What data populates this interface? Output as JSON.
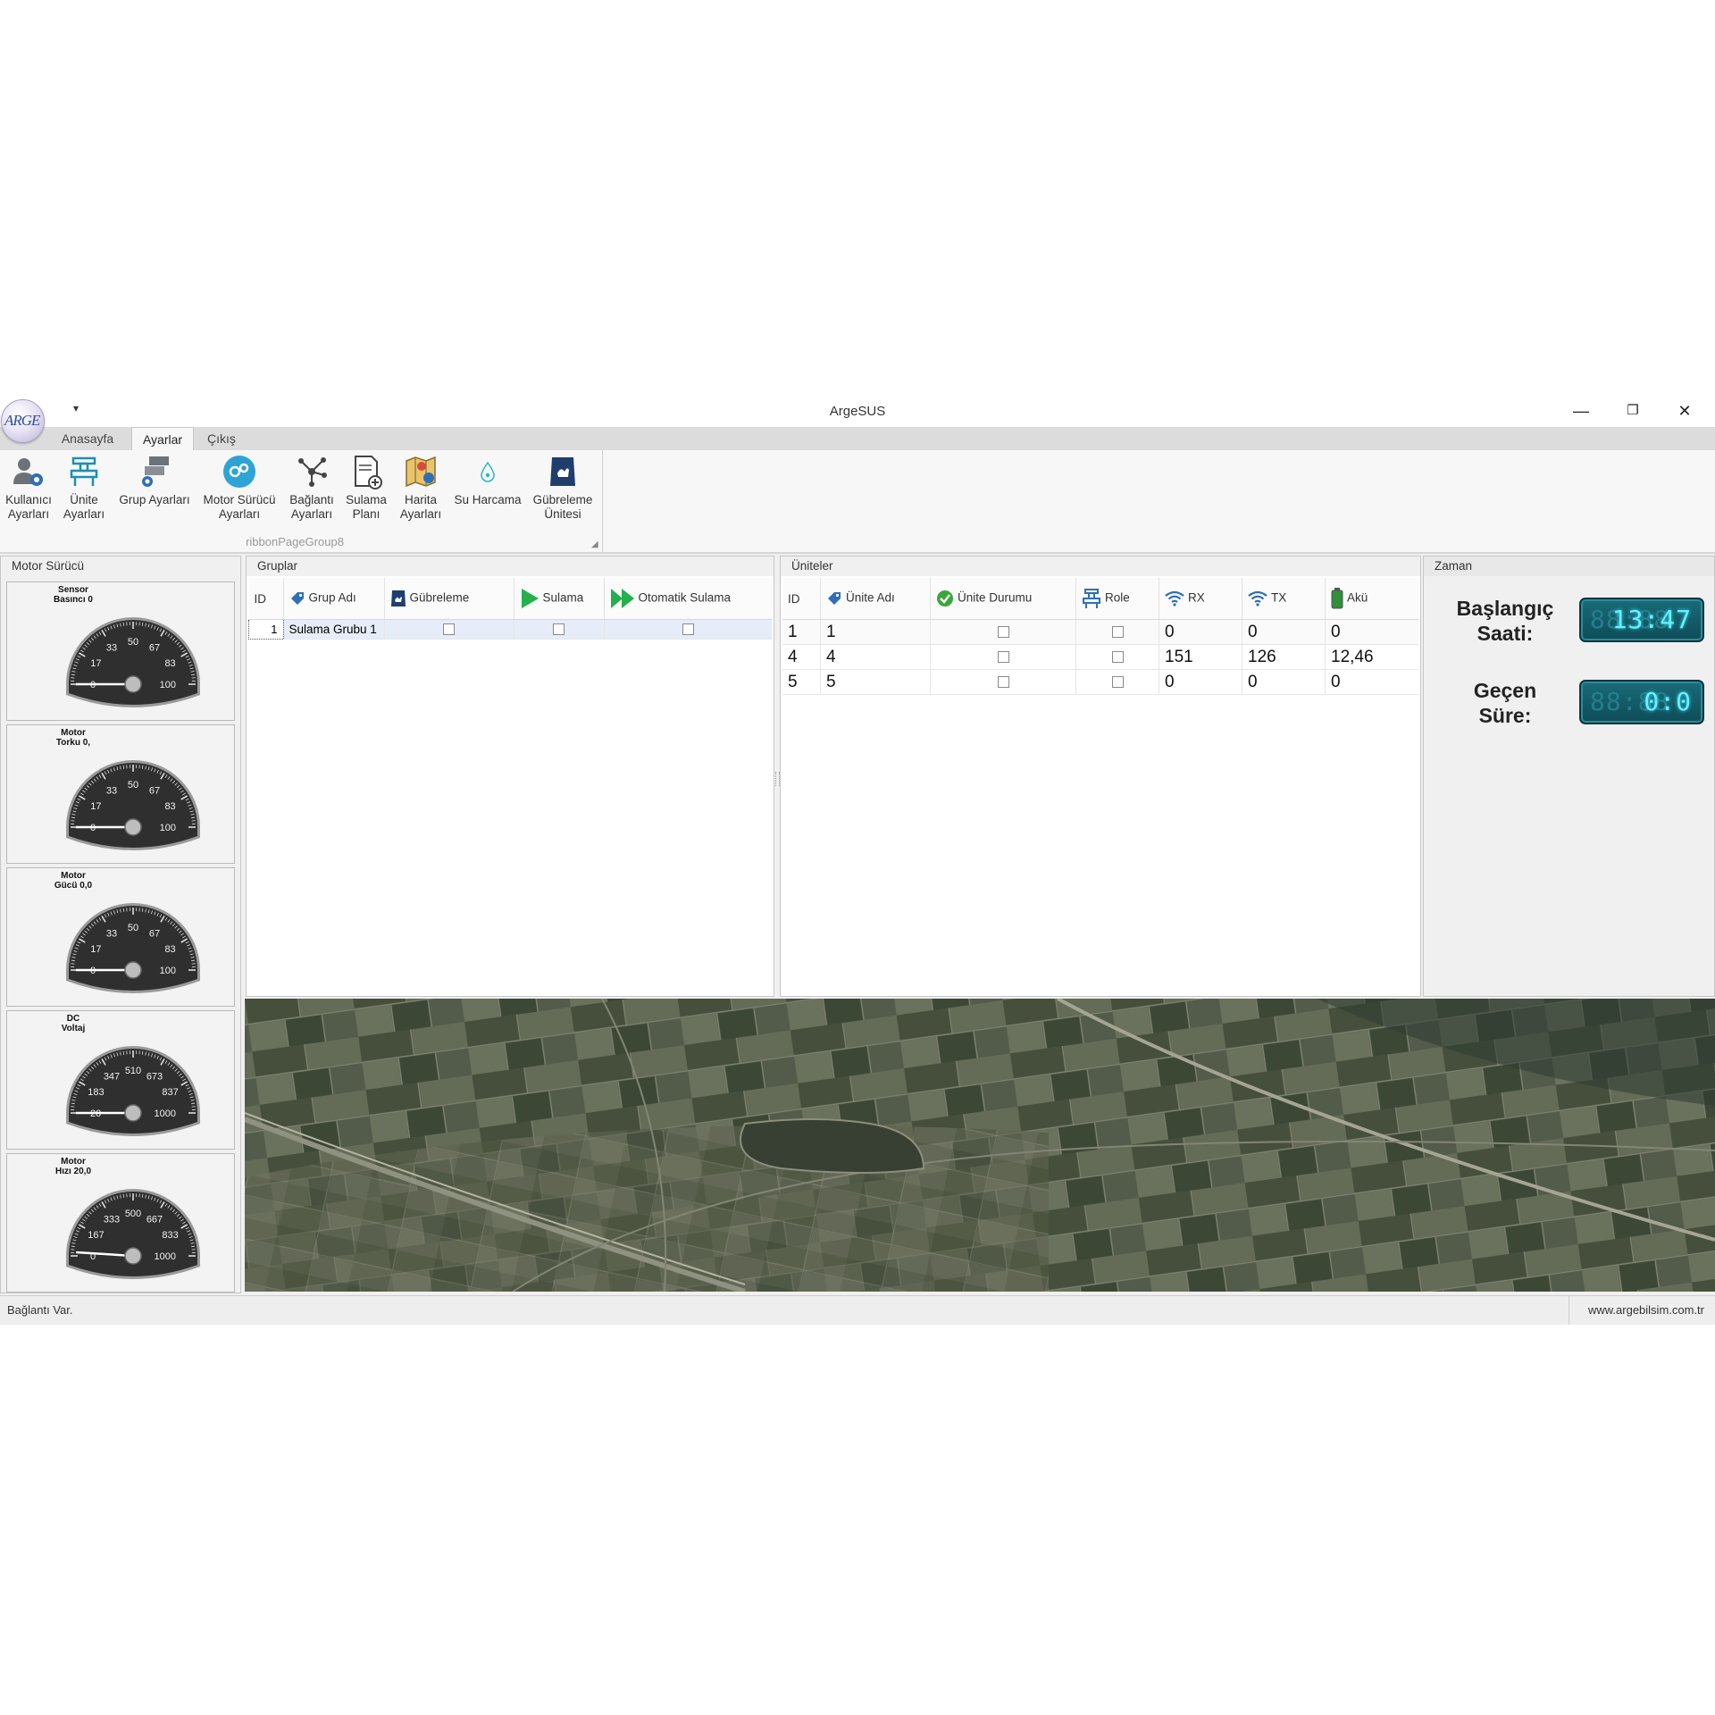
{
  "app": {
    "logo_text": "ARGE",
    "title": "ArgeSUS"
  },
  "window_controls": {
    "minimize": "—",
    "maximize": "❐",
    "close": "✕"
  },
  "tabs": [
    {
      "label": "Anasayfa"
    },
    {
      "label": "Ayarlar"
    },
    {
      "label": "Çıkış"
    }
  ],
  "ribbon": {
    "group_caption": "ribbonPageGroup8",
    "buttons": [
      {
        "line1": "Kullanıcı",
        "line2": "Ayarları",
        "icon": "user-settings-icon"
      },
      {
        "line1": "Ünite",
        "line2": "Ayarları",
        "icon": "unit-settings-icon"
      },
      {
        "line1": "Grup Ayarları",
        "line2": "",
        "icon": "group-settings-icon"
      },
      {
        "line1": "Motor Sürücü",
        "line2": "Ayarları",
        "icon": "motor-driver-icon"
      },
      {
        "line1": "Bağlantı",
        "line2": "Ayarları",
        "icon": "connection-icon"
      },
      {
        "line1": "Sulama",
        "line2": "Planı",
        "icon": "irrigation-plan-icon"
      },
      {
        "line1": "Harita",
        "line2": "Ayarları",
        "icon": "map-settings-icon"
      },
      {
        "line1": "Su Harcama",
        "line2": "",
        "icon": "water-drop-icon"
      },
      {
        "line1": "Gübreleme",
        "line2": "Ünitesi",
        "icon": "fertilizer-bag-icon"
      }
    ]
  },
  "motor_panel": {
    "title": "Motor Sürücü",
    "gauges": [
      {
        "label1": "Sensor",
        "label2": "Basıncı 0",
        "ticks": [
          "0",
          "17",
          "33",
          "50",
          "67",
          "83",
          "100"
        ],
        "value_fraction": 0
      },
      {
        "label1": "Motor",
        "label2": "Torku 0,",
        "ticks": [
          "0",
          "17",
          "33",
          "50",
          "67",
          "83",
          "100"
        ],
        "value_fraction": 0
      },
      {
        "label1": "Motor",
        "label2": "Gücü 0,0",
        "ticks": [
          "0",
          "17",
          "33",
          "50",
          "67",
          "83",
          "100"
        ],
        "value_fraction": 0
      },
      {
        "label1": "DC",
        "label2": "Voltaj",
        "ticks": [
          "20",
          "183",
          "347",
          "510",
          "673",
          "837",
          "1000"
        ],
        "value_fraction": 0
      },
      {
        "label1": "Motor",
        "label2": "Hızı 20,0",
        "ticks": [
          "0",
          "167",
          "333",
          "500",
          "667",
          "833",
          "1000"
        ],
        "value_fraction": 0.02
      }
    ]
  },
  "groups_panel": {
    "title": "Gruplar",
    "columns": {
      "id": "ID",
      "name": "Grup Adı",
      "fert": "Gübreleme",
      "irr": "Sulama",
      "auto": "Otomatik Sulama"
    },
    "rows": [
      {
        "id": "1",
        "name": "Sulama Grubu 1",
        "fert": false,
        "irr": false,
        "auto": false
      }
    ]
  },
  "units_panel": {
    "title": "Üniteler",
    "columns": {
      "id": "ID",
      "name": "Ünite Adı",
      "status": "Ünite Durumu",
      "role": "Role",
      "rx": "RX",
      "tx": "TX",
      "aku": "Akü"
    },
    "rows": [
      {
        "id": "1",
        "name": "1",
        "rx": "0",
        "tx": "0",
        "aku": "0"
      },
      {
        "id": "4",
        "name": "4",
        "rx": "151",
        "tx": "126",
        "aku": "12,46"
      },
      {
        "id": "5",
        "name": "5",
        "rx": "0",
        "tx": "0",
        "aku": "0"
      }
    ]
  },
  "time_panel": {
    "title": "Zaman",
    "start_label_1": "Başlangıç",
    "start_label_2": "Saati:",
    "start_value": "13:47",
    "elapsed_label_1": "Geçen",
    "elapsed_label_2": "Süre:",
    "elapsed_value": "0:0"
  },
  "status": {
    "left": "Bağlantı Var.",
    "right": "www.argebilsim.com.tr"
  },
  "colors": {
    "accent": "#2e6fb8",
    "ribbon_bg": "#f7f7f7",
    "lcd_text": "#66f0ff",
    "selected_row": "#e6ecf8"
  }
}
